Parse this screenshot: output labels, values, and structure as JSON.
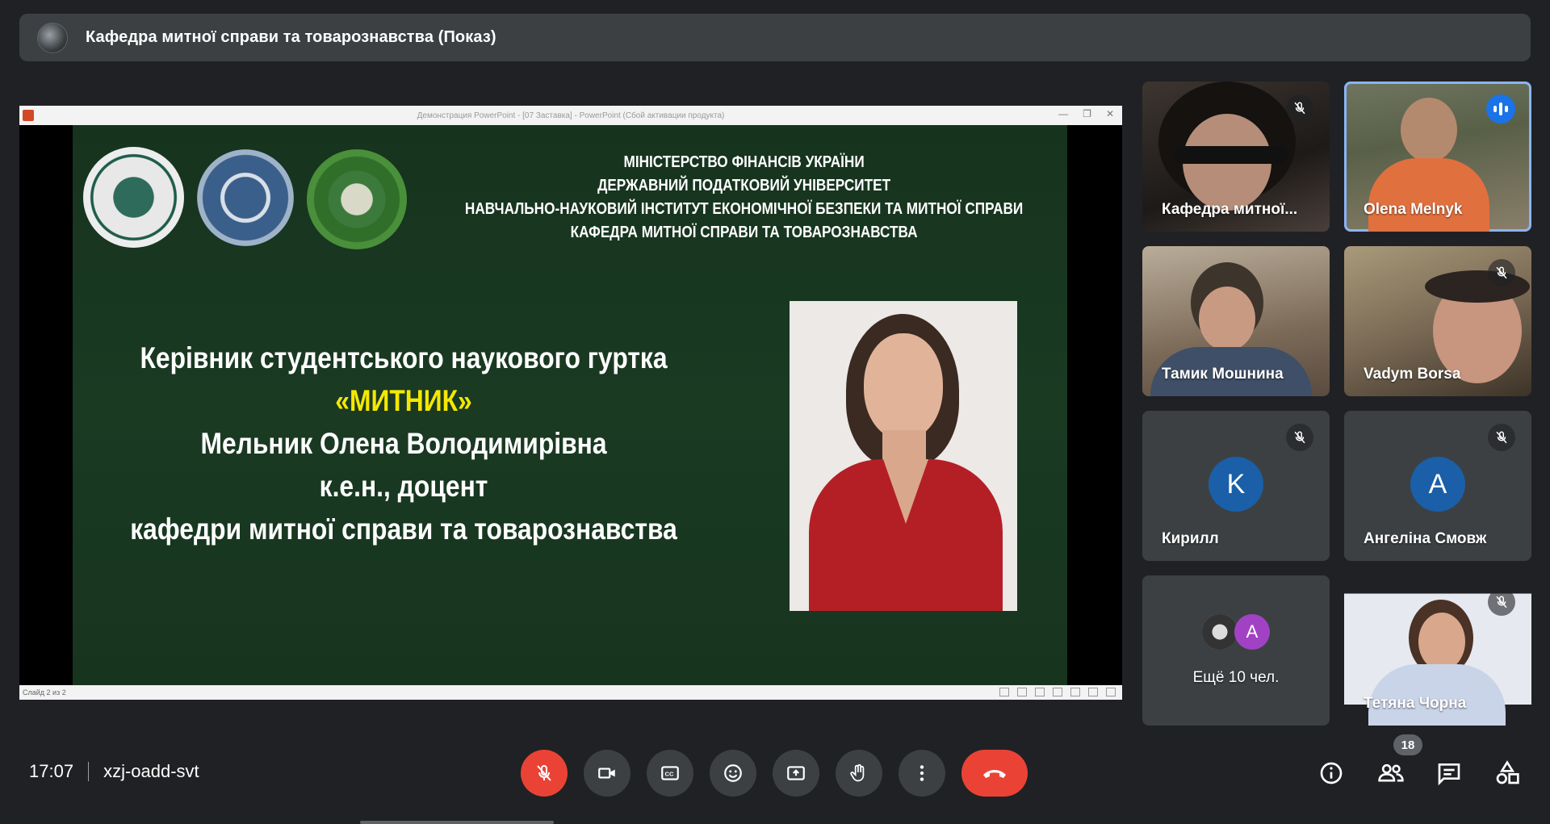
{
  "meeting": {
    "presenter_title": "Кафедра митної справи та товарознавства (Показ)",
    "time": "17:07",
    "code": "xzj-oadd-svt",
    "participants_count": "18"
  },
  "shared_screen": {
    "window_title": "Демонстрация PowerPoint - [07 Заставка] - PowerPoint (Сбой активации продукта)",
    "status_text": "Слайд 2 из 2",
    "slide": {
      "org_lines": [
        "МІНІСТЕРСТВО ФІНАНСІВ УКРАЇНИ",
        "ДЕРЖАВНИЙ ПОДАТКОВИЙ УНІВЕРСИТЕТ",
        "НАВЧАЛЬНО-НАУКОВИЙ ІНСТИТУТ ЕКОНОМІЧНОЇ БЕЗПЕКИ ТА МИТНОЇ СПРАВИ",
        "КАФЕДРА МИТНОЇ СПРАВИ ТА ТОВАРОЗНАВСТВА"
      ],
      "lines": [
        "Керівник студентського наукового гуртка",
        "«МИТНИК»",
        "Мельник Олена Володимирівна",
        "к.е.н., доцент",
        "кафедри митної справи та товарознавства"
      ],
      "highlight_color": "#f5e800"
    }
  },
  "participants": [
    {
      "name": "Кафедра митної...",
      "state": "muted"
    },
    {
      "name": "Olena Melnyk",
      "state": "speaking"
    },
    {
      "name": "Тамик Мошнина",
      "state": "none"
    },
    {
      "name": "Vadym Borsa",
      "state": "muted"
    },
    {
      "name": "Кирилл",
      "initial": "K",
      "avatar_color": "#1a5fa8",
      "state": "muted"
    },
    {
      "name": "Ангеліна Смовж",
      "initial": "A",
      "avatar_color": "#1a5fa8",
      "state": "muted"
    },
    {
      "name": "Тетяна Чорна",
      "state": "muted"
    }
  ],
  "more_tile": {
    "label": "Ещё 10 чел.",
    "initial": "A",
    "avatar_color": "#a142c4"
  },
  "controls": {
    "mic": "mic-off-icon",
    "camera": "camera-icon",
    "captions": "captions-icon",
    "reactions": "emoji-icon",
    "present": "present-icon",
    "raise_hand": "hand-icon",
    "more": "more-vert-icon",
    "leave": "end-call-icon"
  },
  "colors": {
    "accent": "#8ab4f8",
    "danger": "#ea4335",
    "surface": "#3c4043",
    "background": "#202124"
  }
}
